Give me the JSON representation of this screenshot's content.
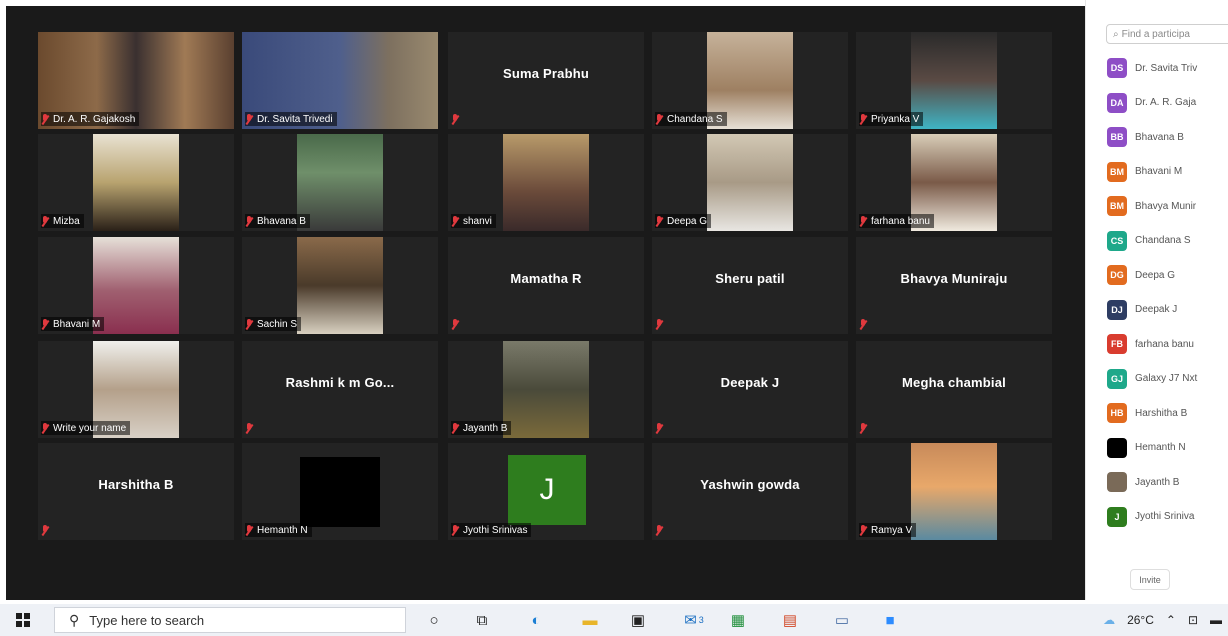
{
  "gallery": {
    "tiles": [
      {
        "name": "Dr. A. R. Gajakosh",
        "center": ""
      },
      {
        "name": "Dr. Savita Trivedi",
        "center": ""
      },
      {
        "name": "",
        "center": "Suma Prabhu"
      },
      {
        "name": "Chandana S",
        "center": ""
      },
      {
        "name": "Priyanka V",
        "center": ""
      },
      {
        "name": "Mizba",
        "center": ""
      },
      {
        "name": "Bhavana B",
        "center": ""
      },
      {
        "name": "shanvi",
        "center": ""
      },
      {
        "name": "Deepa G",
        "center": ""
      },
      {
        "name": "farhana banu",
        "center": ""
      },
      {
        "name": "Bhavani M",
        "center": ""
      },
      {
        "name": "Sachin S",
        "center": ""
      },
      {
        "name": "",
        "center": "Mamatha R"
      },
      {
        "name": "",
        "center": "Sheru patil"
      },
      {
        "name": "",
        "center": "Bhavya Muniraju"
      },
      {
        "name": "Write your name",
        "center": ""
      },
      {
        "name": "",
        "center": "Rashmi k m Go..."
      },
      {
        "name": "Jayanth B",
        "center": ""
      },
      {
        "name": "",
        "center": "Deepak J"
      },
      {
        "name": "",
        "center": "Megha chambial"
      },
      {
        "name": "",
        "center": "Harshitha B"
      },
      {
        "name": "Hemanth N",
        "center": ""
      },
      {
        "name": "Jyothi Srinivas",
        "center": ""
      },
      {
        "name": "",
        "center": "Yashwin gowda"
      },
      {
        "name": "Ramya V",
        "center": ""
      }
    ],
    "avatar_letter": "J"
  },
  "panel": {
    "search_placeholder": "Find a participa",
    "participants": [
      {
        "initials": "DS",
        "name": "Dr. Savita Triv",
        "color": "#8e4ec6"
      },
      {
        "initials": "DA",
        "name": "Dr. A. R. Gaja",
        "color": "#8e4ec6"
      },
      {
        "initials": "BB",
        "name": "Bhavana B",
        "color": "#8e4ec6"
      },
      {
        "initials": "BM",
        "name": "Bhavani M",
        "color": "#e26b1f"
      },
      {
        "initials": "BM",
        "name": "Bhavya Munir",
        "color": "#e26b1f"
      },
      {
        "initials": "CS",
        "name": "Chandana S",
        "color": "#1ea88a"
      },
      {
        "initials": "DG",
        "name": "Deepa G",
        "color": "#e26b1f"
      },
      {
        "initials": "DJ",
        "name": "Deepak J",
        "color": "#2e3d63"
      },
      {
        "initials": "FB",
        "name": "farhana banu",
        "color": "#d93c2f"
      },
      {
        "initials": "GJ",
        "name": "Galaxy J7 Nxt",
        "color": "#1ea88a"
      },
      {
        "initials": "HB",
        "name": "Harshitha B",
        "color": "#e26b1f"
      },
      {
        "initials": "",
        "name": "Hemanth N",
        "color": "#000000"
      },
      {
        "initials": "",
        "name": "Jayanth B",
        "color": "#7a6a58"
      },
      {
        "initials": "J",
        "name": "Jyothi Sriniva",
        "color": "#2e7d1e"
      }
    ],
    "invite_label": "Invite"
  },
  "taskbar": {
    "search_placeholder": "Type here to search",
    "weather": "26°C",
    "badge_count": "3"
  },
  "colors": {
    "gallery_bg": "#1a1a1a",
    "tile_bg": "#232323",
    "active_speaker": "#c9d75a",
    "mute_red": "#e0393e"
  }
}
